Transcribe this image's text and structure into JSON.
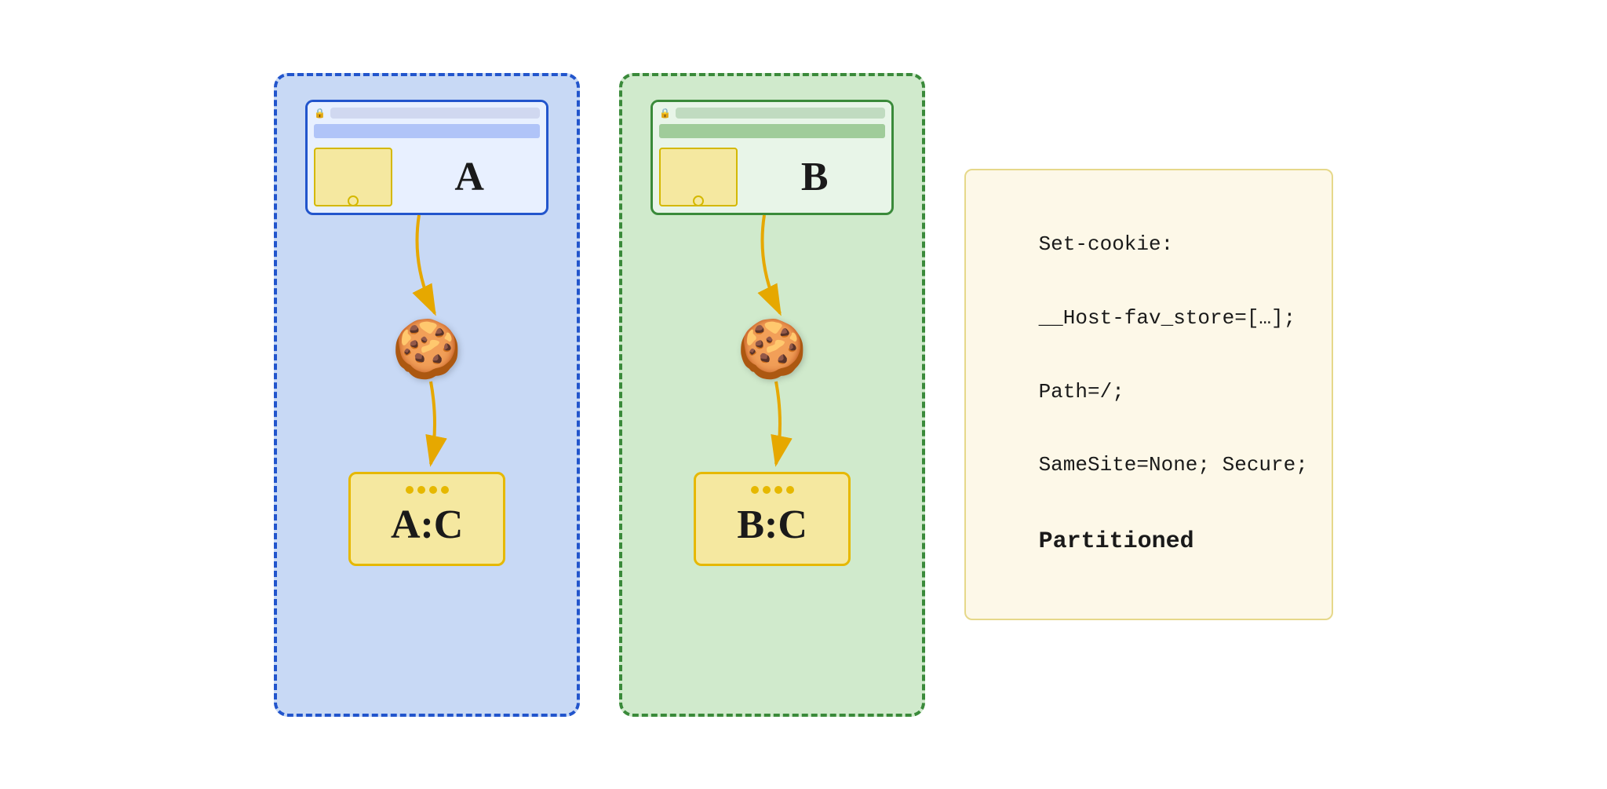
{
  "diagram": {
    "partitions": [
      {
        "id": "partition-a",
        "color": "blue",
        "browser_label": "A",
        "storage_label": "A:C",
        "border_color": "#2255cc",
        "bg_color": "#c8d9f5"
      },
      {
        "id": "partition-b",
        "color": "green",
        "browser_label": "B",
        "storage_label": "B:C",
        "border_color": "#3a8a3a",
        "bg_color": "#d0eacc"
      }
    ],
    "code_block": {
      "lines": [
        "Set-cookie:",
        "__Host-fav_store=[…];",
        "Path=/;",
        "SameSite=None; Secure;",
        "Partitioned"
      ],
      "bold_line_index": 4
    }
  }
}
